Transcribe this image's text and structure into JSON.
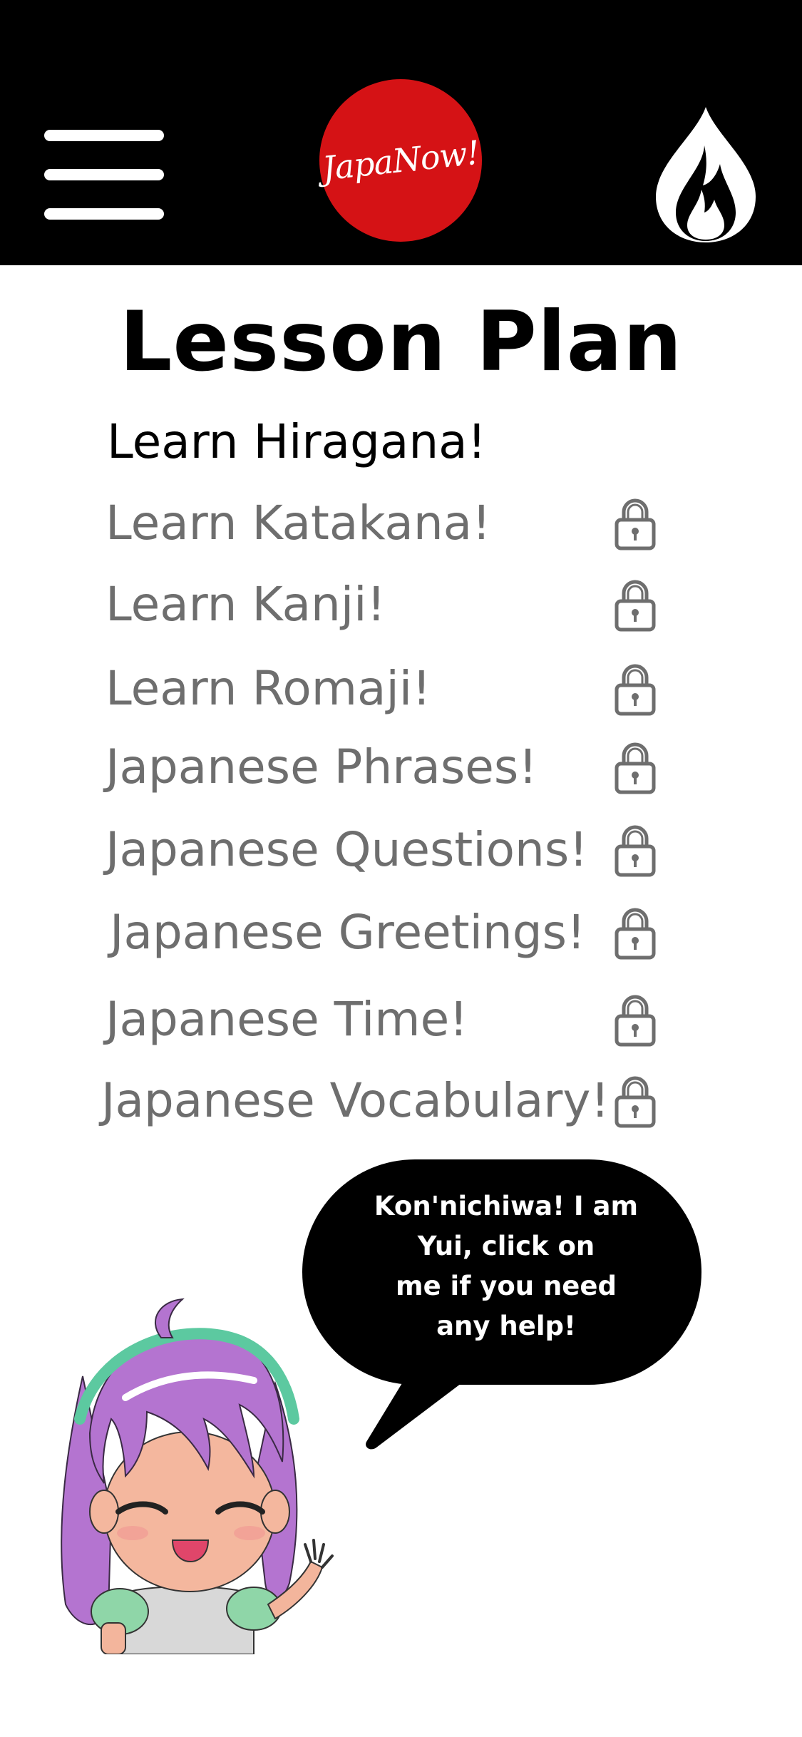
{
  "header": {
    "menu_icon": "hamburger-menu-icon",
    "logo_text": "JapaNow!",
    "logo_color": "#d51215",
    "streak_icon": "flame-icon"
  },
  "page_title": "Lesson Plan",
  "lessons": [
    {
      "label": "Learn Hiragana!",
      "locked": false
    },
    {
      "label": "Learn Katakana!",
      "locked": true
    },
    {
      "label": "Learn Kanji!",
      "locked": true
    },
    {
      "label": "Learn Romaji!",
      "locked": true
    },
    {
      "label": "Japanese Phrases!",
      "locked": true
    },
    {
      "label": "Japanese Questions!",
      "locked": true
    },
    {
      "label": "Japanese Greetings!",
      "locked": true
    },
    {
      "label": "Japanese Time!",
      "locked": true
    },
    {
      "label": "Japanese Vocabulary!",
      "locked": true
    }
  ],
  "lock_icon": "padlock-icon",
  "assistant": {
    "bubble_lines": [
      "Kon'nichiwa! I am",
      "Yui, click on",
      "me if you need",
      "any help!"
    ],
    "mascot_icon": "anime-girl-mascot"
  }
}
